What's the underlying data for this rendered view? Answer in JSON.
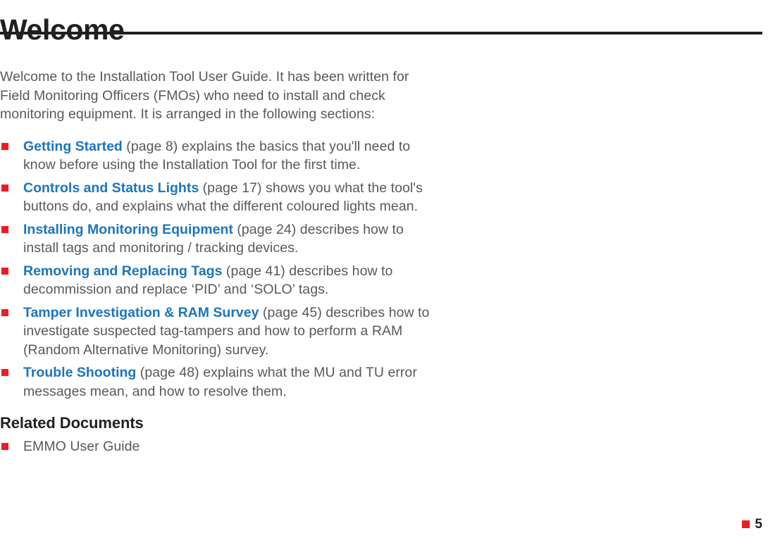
{
  "document": {
    "title": "Welcome",
    "page_number": "5"
  },
  "intro": {
    "paragraph": "Welcome to the Installation Tool User Guide. It has been written for Field Monitoring Officers (FMOs) who need to install and check monitoring equipment. It is arranged in the following sections:"
  },
  "sections": [
    {
      "link": "Getting Started",
      "description": " (page 8) explains the basics that you'll need to know before using the Installation Tool for the first time."
    },
    {
      "link": "Controls and Status Lights",
      "description": " (page 17) shows you what the tool's buttons do, and explains what the different coloured lights mean."
    },
    {
      "link": "Installing Monitoring Equipment",
      "description": " (page 24) describes how to install tags and monitoring / tracking devices."
    },
    {
      "link": "Removing and Replacing Tags",
      "description": " (page 41) describes how to decommission and replace ‘PID’ and ‘SOLO’ tags."
    },
    {
      "link": "Tamper Investigation & RAM Survey",
      "description": " (page 45) describes how to investigate suspected tag-tampers and how to perform a RAM (Random Alternative Monitoring) survey."
    },
    {
      "link": "Trouble Shooting",
      "description": " (page 48) explains what the MU and TU error messages mean, and how to resolve them."
    }
  ],
  "related_documents": {
    "heading": "Related Documents",
    "items": [
      {
        "label": "EMMO User Guide"
      }
    ]
  },
  "colors": {
    "link_blue": "#1c75bc",
    "marker_red": "#ed1c24",
    "body_gray": "#58595b",
    "heading_black": "#231f20"
  }
}
